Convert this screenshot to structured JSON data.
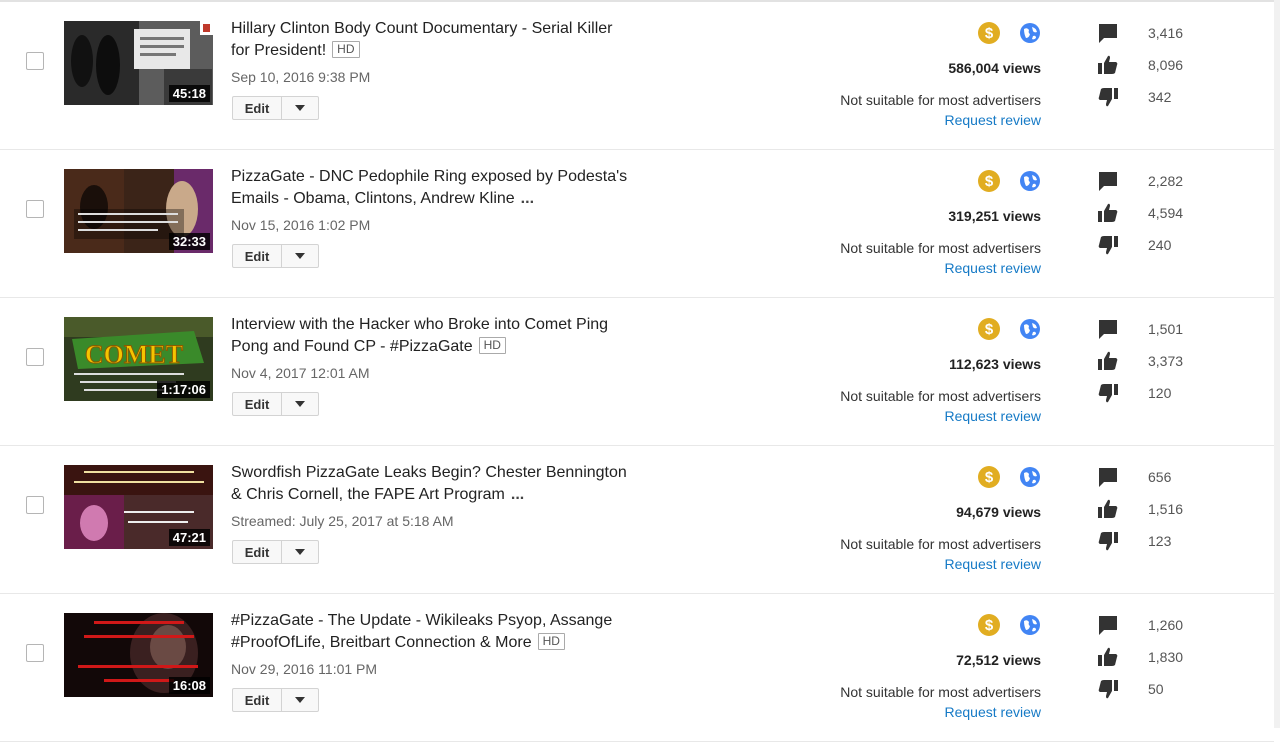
{
  "edit_label": "Edit",
  "colors": {
    "monetize": "#e1ad21",
    "public": "#4285f4",
    "link": "#167ac6",
    "icon": "#333333"
  },
  "icons": {
    "monetize": "dollar-coin-icon",
    "visibility": "globe-icon",
    "comments": "comment-icon",
    "likes": "thumbs-up-icon",
    "dislikes": "thumbs-down-icon",
    "menu": "chevron-down-icon"
  },
  "videos": [
    {
      "title": "Hillary Clinton Body Count Documentary - Serial Killer for President!",
      "hd": "HD",
      "date": "Sep 10, 2016 9:38 PM",
      "duration": "45:18",
      "views": "586,004 views",
      "monetization": "Not suitable for most advertisers",
      "review": "Request review",
      "comments": "3,416",
      "likes": "8,096",
      "dislikes": "342"
    },
    {
      "title": "PizzaGate - DNC Pedophile Ring exposed by Podesta's Emails - Obama, Clintons, Andrew Kline",
      "more": "...",
      "date": "Nov 15, 2016 1:02 PM",
      "duration": "32:33",
      "views": "319,251 views",
      "monetization": "Not suitable for most advertisers",
      "review": "Request review",
      "comments": "2,282",
      "likes": "4,594",
      "dislikes": "240"
    },
    {
      "title": "Interview with the Hacker who Broke into Comet Ping Pong and Found CP - #PizzaGate",
      "hd": "HD",
      "date": "Nov 4, 2017 12:01 AM",
      "duration": "1:17:06",
      "thumb_text": "COMET",
      "views": "112,623 views",
      "monetization": "Not suitable for most advertisers",
      "review": "Request review",
      "comments": "1,501",
      "likes": "3,373",
      "dislikes": "120"
    },
    {
      "title": "Swordfish PizzaGate Leaks Begin? Chester Bennington & Chris Cornell, the FAPE Art Program",
      "more": "...",
      "date": "Streamed: July 25, 2017 at 5:18 AM",
      "duration": "47:21",
      "views": "94,679 views",
      "monetization": "Not suitable for most advertisers",
      "review": "Request review",
      "comments": "656",
      "likes": "1,516",
      "dislikes": "123"
    },
    {
      "title": "#PizzaGate - The Update - Wikileaks Psyop, Assange #ProofOfLife, Breitbart Connection & More",
      "hd": "HD",
      "date": "Nov 29, 2016 11:01 PM",
      "duration": "16:08",
      "views": "72,512 views",
      "monetization": "Not suitable for most advertisers",
      "review": "Request review",
      "comments": "1,260",
      "likes": "1,830",
      "dislikes": "50"
    }
  ]
}
